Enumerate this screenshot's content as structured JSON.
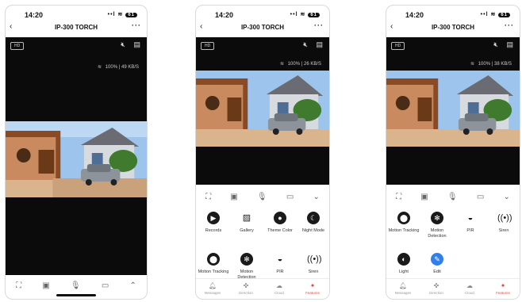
{
  "status_bar": {
    "time": "14:20",
    "signal": "••l",
    "wifi": "≋",
    "battery": "61"
  },
  "title_bar": {
    "back": "‹",
    "title": "IP-300 TORCH",
    "more": "···"
  },
  "stream": {
    "hd_badge": "HD",
    "mute_icon": "speaker-muted-icon",
    "gallery_icon": "tile-view-icon",
    "phone1_quality": "100%",
    "phone1_rate": "49 KB/S",
    "phone2_quality": "100%",
    "phone2_rate": "26 KB/S",
    "phone3_quality": "100%",
    "phone3_rate": "38 KB/S"
  },
  "controls": {
    "icons": [
      "fullscreen-icon",
      "screenshot-icon",
      "microphone-icon",
      "record-icon",
      "expand-icon"
    ]
  },
  "features": {
    "records": "Records",
    "gallery": "Gallery",
    "theme_color": "Theme Color",
    "night_mode": "Night Mode",
    "motion_tracking": "Motion Tracking",
    "motion_detection": "Motion Detection",
    "pir": "PIR",
    "siren": "Siren",
    "light": "Light",
    "edit": "Edit"
  },
  "tabs": {
    "messages": "Messages",
    "direction": "Direction",
    "cloud": "Cloud",
    "features": "Features"
  },
  "colors": {
    "accent_red": "#e84a3c",
    "edit_blue": "#2f80ed",
    "video_black": "#0b0b0b"
  }
}
